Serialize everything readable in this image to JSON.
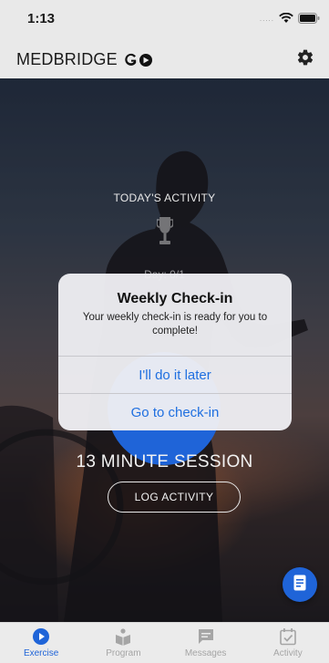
{
  "status_bar": {
    "time": "1:13",
    "signal": "....."
  },
  "header": {
    "brand_name": "MEDBRIDGE",
    "brand_suffix": "GO",
    "settings_icon": "gear-icon"
  },
  "hero": {
    "section_title": "TODAY'S ACTIVITY",
    "trophy_icon": "trophy-icon",
    "streak_text": "Day: 0/1",
    "session_title": "13 MINUTE SESSION",
    "log_button_label": "LOG ACTIVITY",
    "fab_icon": "document-icon"
  },
  "alert": {
    "title": "Weekly Check-in",
    "message": "Your weekly check-in is ready for you to complete!",
    "actions": [
      {
        "label": "I'll do it later"
      },
      {
        "label": "Go to check-in"
      }
    ]
  },
  "tabs": [
    {
      "label": "Exercise",
      "icon": "play-circle-icon",
      "active": true
    },
    {
      "label": "Program",
      "icon": "program-icon",
      "active": false
    },
    {
      "label": "Messages",
      "icon": "messages-icon",
      "active": false
    },
    {
      "label": "Activity",
      "icon": "calendar-check-icon",
      "active": false
    }
  ],
  "colors": {
    "accent": "#1f64d8",
    "alert_action": "#1f6fe0",
    "inactive_tab": "#a5a5a5"
  }
}
